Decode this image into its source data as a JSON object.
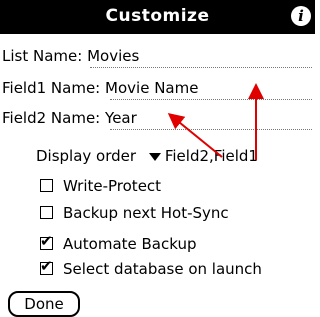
{
  "title": "Customize",
  "info_icon": "info-icon",
  "list_name": {
    "label": "List Name:",
    "value": "Movies"
  },
  "field1_name": {
    "label": "Field1 Name:",
    "value": "Movie Name"
  },
  "field2_name": {
    "label": "Field2 Name:",
    "value": "Year"
  },
  "display_order": {
    "label": "Display order",
    "value": "Field2,Field1"
  },
  "options": [
    {
      "label": "Write-Protect",
      "checked": false
    },
    {
      "label": "Backup next Hot-Sync",
      "checked": false
    },
    {
      "label": "Automate Backup",
      "checked": true
    },
    {
      "label": "Select database on launch",
      "checked": true
    }
  ],
  "done_label": "Done",
  "annotation_color": "#e00000"
}
